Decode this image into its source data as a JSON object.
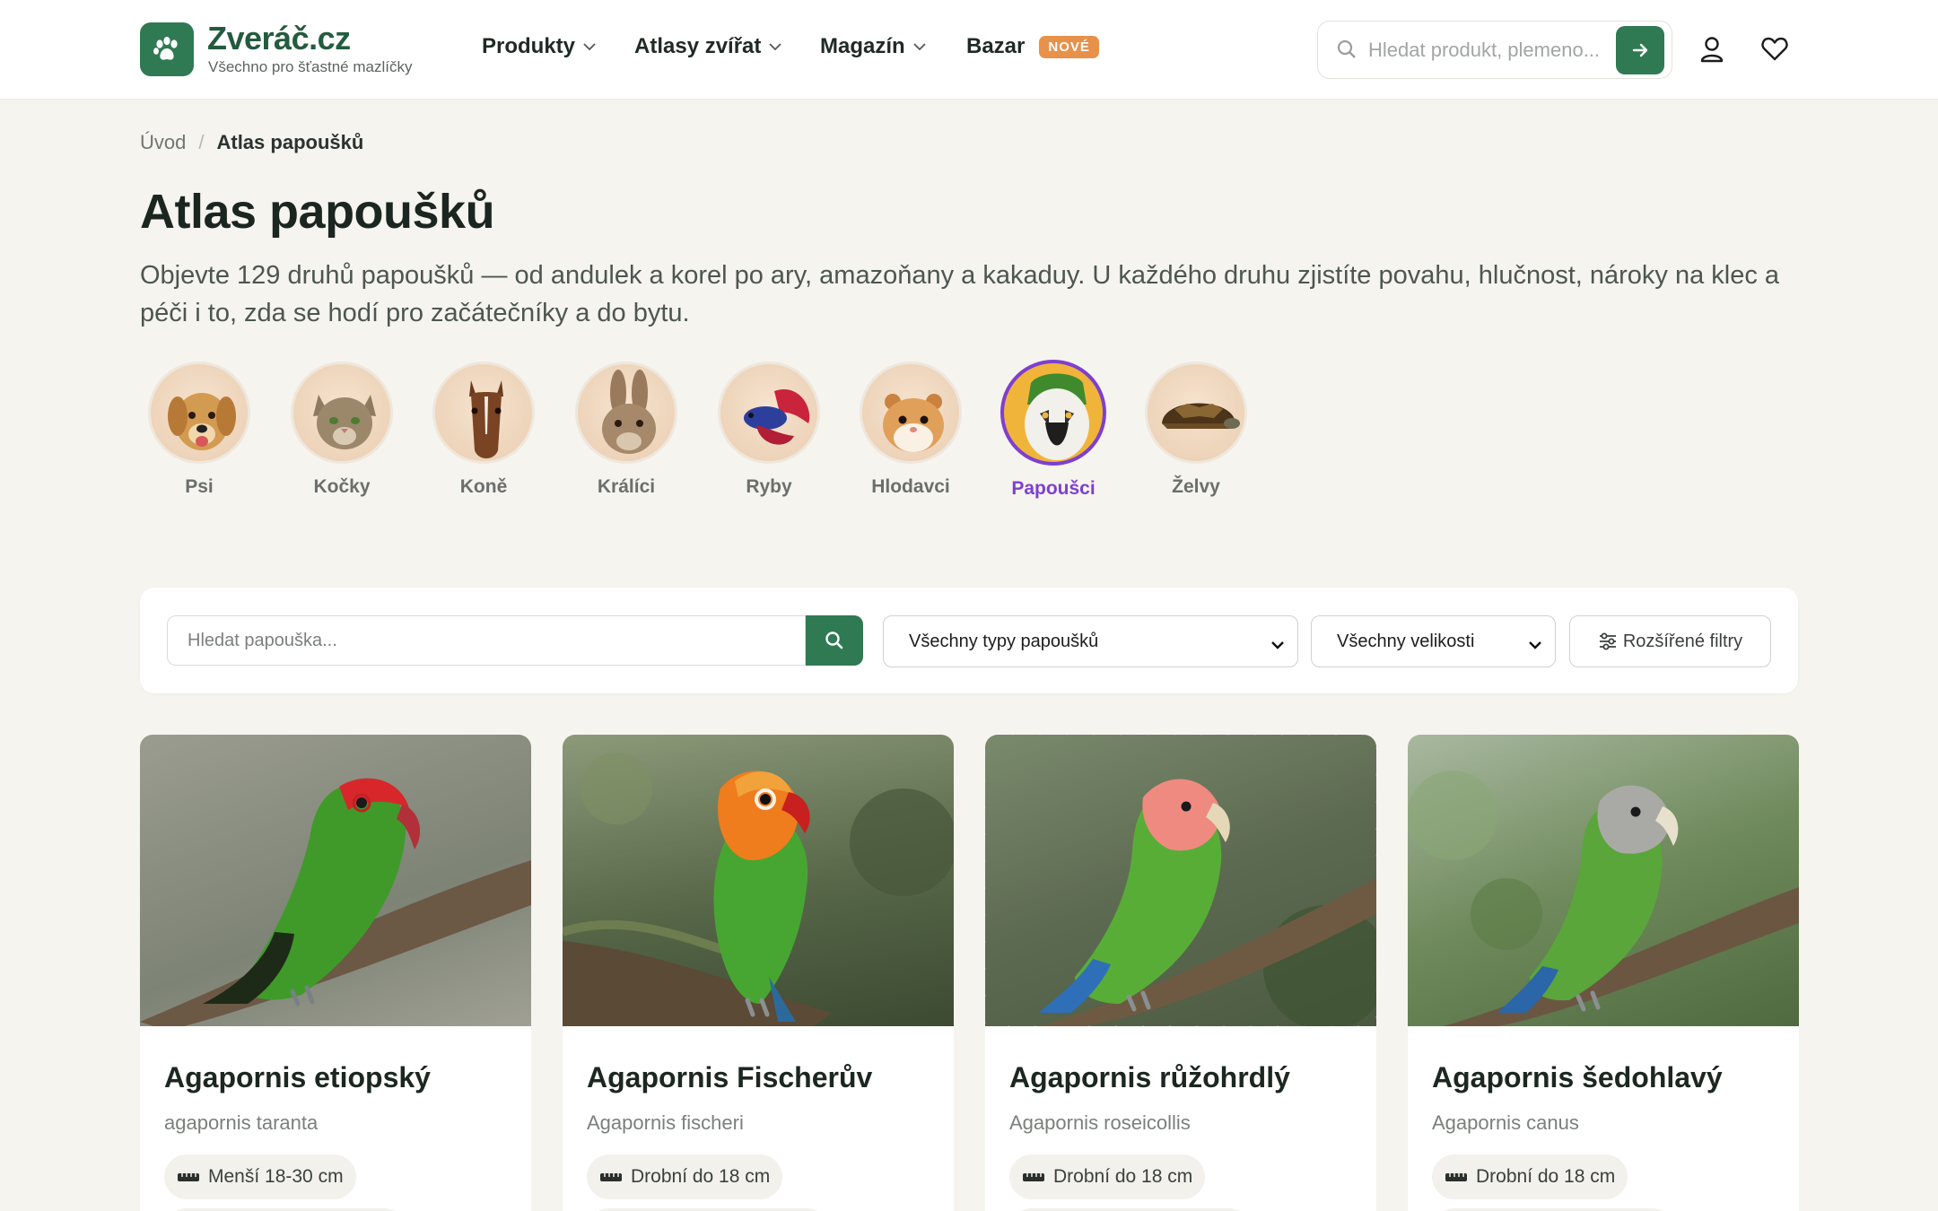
{
  "header": {
    "brand": "Zveráč.cz",
    "tagline": "Všechno pro šťastné mazlíčky",
    "nav": [
      {
        "label": "Produkty"
      },
      {
        "label": "Atlasy zvířat"
      },
      {
        "label": "Magazín"
      },
      {
        "label": "Bazar",
        "badge": "NOVÉ"
      }
    ],
    "search_placeholder": "Hledat produkt, plemeno..."
  },
  "breadcrumb": {
    "home": "Úvod",
    "separator": "/",
    "current": "Atlas papoušků"
  },
  "page": {
    "title": "Atlas papoušků",
    "description": "Objevte 129 druhů papoušků — od andulek a korel po ary, amazoňany a kakaduy. U každého druhu zjistíte povahu, hlučnost, nároky na klec a péči i to, zda se hodí pro začátečníky a do bytu."
  },
  "categories": [
    {
      "label": "Psi",
      "icon": "dog"
    },
    {
      "label": "Kočky",
      "icon": "cat"
    },
    {
      "label": "Koně",
      "icon": "horse"
    },
    {
      "label": "Králíci",
      "icon": "rabbit"
    },
    {
      "label": "Ryby",
      "icon": "fish"
    },
    {
      "label": "Hlodavci",
      "icon": "hamster"
    },
    {
      "label": "Papoušci",
      "icon": "parrot",
      "active": true
    },
    {
      "label": "Želvy",
      "icon": "turtle"
    }
  ],
  "filters": {
    "search_placeholder": "Hledat papouška...",
    "type_selected": "Všechny typy papoušků",
    "size_selected": "Všechny velikosti",
    "advanced_label": "Rozšířené filtry"
  },
  "cards": [
    {
      "name": "Agapornis etiopský",
      "latin": "agapornis taranta",
      "size": "Menší 18-30 cm",
      "head_color": "#d8272b",
      "body_color": "#3f9a2a",
      "bg": "#8c8f84"
    },
    {
      "name": "Agapornis Fischerův",
      "latin": "Agapornis fischeri",
      "size": "Drobní do 18 cm",
      "head_color": "#ef7d1d",
      "body_color": "#47a631",
      "bg": "#566647"
    },
    {
      "name": "Agapornis růžohrdlý",
      "latin": "Agapornis roseicollis",
      "size": "Drobní do 18 cm",
      "head_color": "#ef8a80",
      "body_color": "#58ad37",
      "bg": "#5d6a52"
    },
    {
      "name": "Agapornis šedohlavý",
      "latin": "Agapornis canus",
      "size": "Drobní do 18 cm",
      "head_color": "#a9aaa6",
      "body_color": "#5aa63b",
      "bg": "#6f8a5c"
    }
  ],
  "colors": {
    "brand_green": "#2f7a53",
    "accent_purple": "#7e3fd0",
    "badge_orange": "#e8914a"
  }
}
